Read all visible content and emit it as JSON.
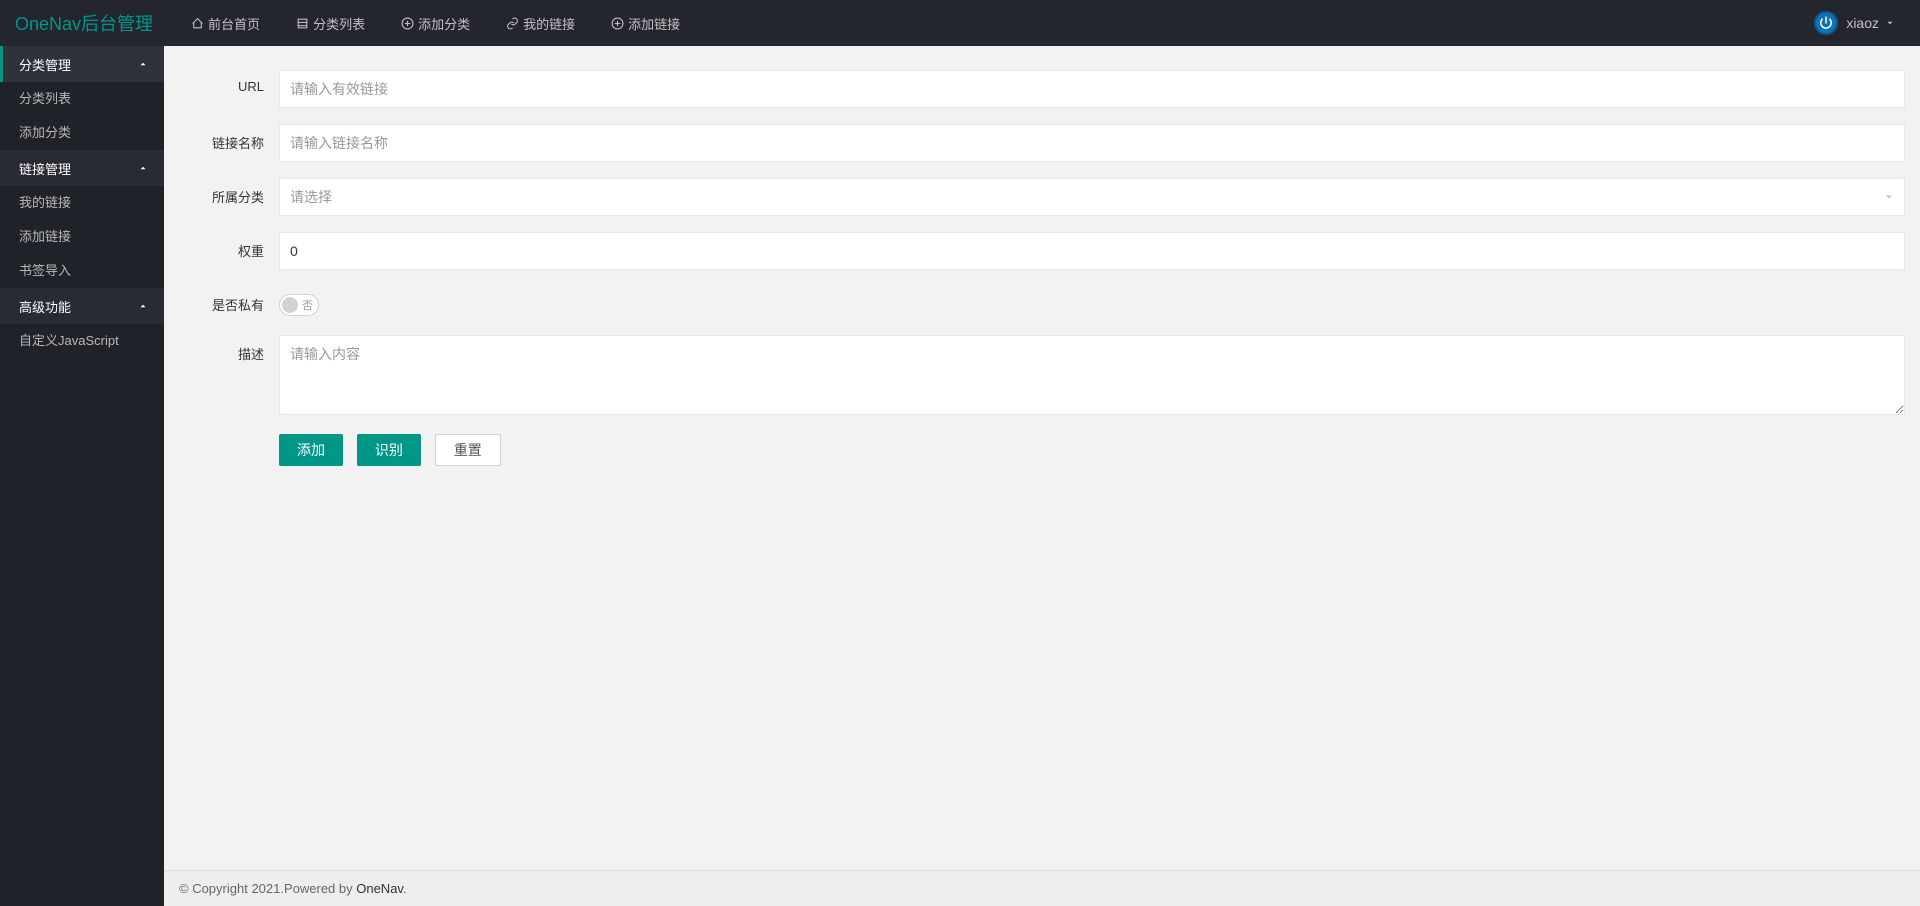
{
  "header": {
    "logo": "OneNav后台管理",
    "nav": [
      {
        "label": "前台首页",
        "icon": "home"
      },
      {
        "label": "分类列表",
        "icon": "list"
      },
      {
        "label": "添加分类",
        "icon": "plus-circle"
      },
      {
        "label": "我的链接",
        "icon": "link"
      },
      {
        "label": "添加链接",
        "icon": "plus-circle"
      }
    ],
    "user": "xiaoz"
  },
  "sidebar": {
    "groups": [
      {
        "title": "分类管理",
        "items": [
          {
            "label": "分类列表"
          },
          {
            "label": "添加分类"
          }
        ]
      },
      {
        "title": "链接管理",
        "items": [
          {
            "label": "我的链接"
          },
          {
            "label": "添加链接"
          },
          {
            "label": "书签导入"
          }
        ]
      },
      {
        "title": "高级功能",
        "items": [
          {
            "label": "自定义JavaScript"
          }
        ]
      }
    ]
  },
  "form": {
    "url": {
      "label": "URL",
      "placeholder": "请输入有效链接",
      "value": ""
    },
    "name": {
      "label": "链接名称",
      "placeholder": "请输入链接名称",
      "value": ""
    },
    "category": {
      "label": "所属分类",
      "placeholder": "请选择"
    },
    "weight": {
      "label": "权重",
      "value": "0"
    },
    "private": {
      "label": "是否私有",
      "off_text": "否"
    },
    "description": {
      "label": "描述",
      "placeholder": "请输入内容",
      "value": ""
    },
    "buttons": {
      "add": "添加",
      "recognize": "识别",
      "reset": "重置"
    }
  },
  "footer": {
    "copyright": "© Copyright 2021.Powered by ",
    "link_text": "OneNav",
    "suffix": "."
  }
}
